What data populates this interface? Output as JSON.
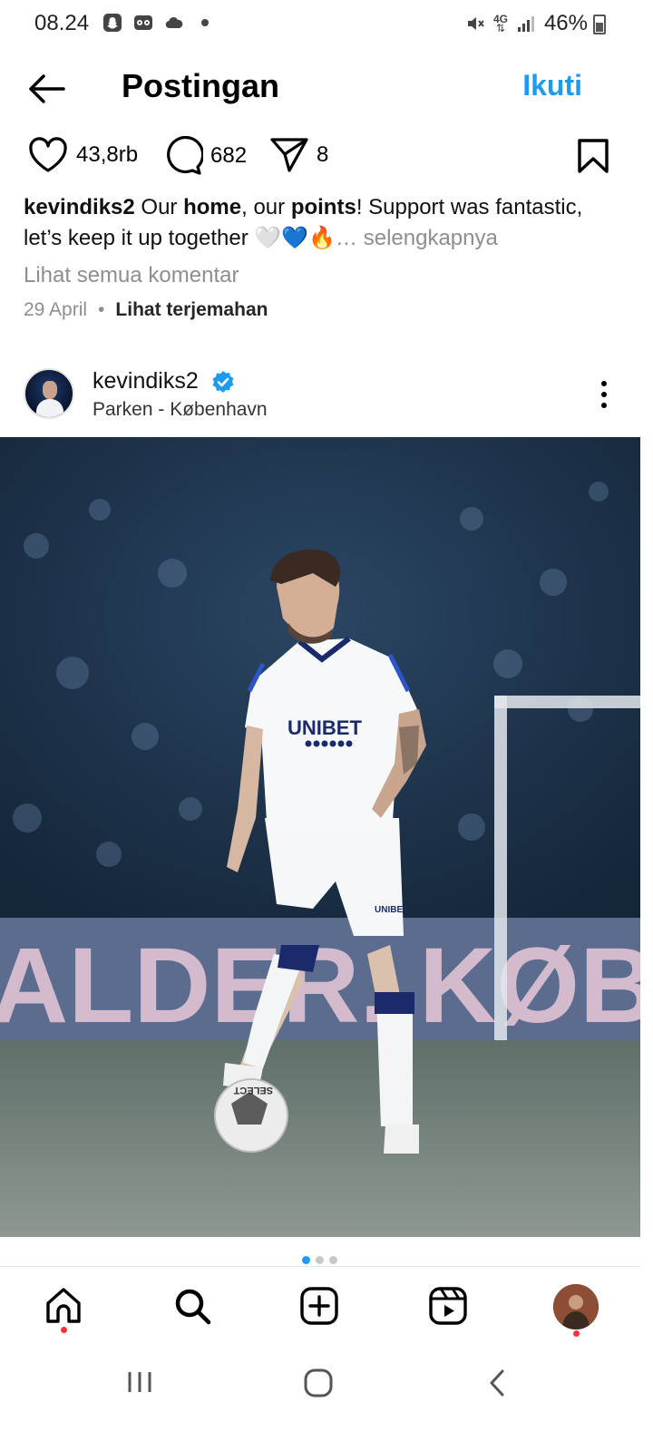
{
  "status_bar": {
    "time": "08.24",
    "network": "4G",
    "battery": "46%"
  },
  "header": {
    "title": "Postingan",
    "follow_label": "Ikuti"
  },
  "actions": {
    "likes": "43,8rb",
    "comments": "682",
    "shares": "8"
  },
  "caption": {
    "username": "kevindiks2",
    "text_1": " Our ",
    "bold_1": "home",
    "text_2": ", our ",
    "bold_2": "points",
    "text_3": "! Support was fantastic, let’s keep it up together ",
    "emojis": "🤍💙🔥",
    "more": "… selengkapnya"
  },
  "view_comments": "Lihat semua komentar",
  "meta": {
    "date": "29 April",
    "separator": "•",
    "translate": "Lihat terjemahan"
  },
  "next_post": {
    "username": "kevindiks2",
    "location": "Parken  - København",
    "photo": {
      "sponsor": "UNIBET",
      "shorts_sponsor": "UNIBET",
      "ball_brand": "SELECT",
      "banner_text": "ALDER. KØB"
    }
  },
  "carousel": {
    "count": 3,
    "active_index": 0
  },
  "bottom_nav": {
    "items": [
      "home-icon",
      "search-icon",
      "create-icon",
      "reels-icon",
      "profile-avatar"
    ]
  },
  "colors": {
    "accent": "#1d9bf0",
    "notification": "#ff3040",
    "muted": "#8e8e8e"
  }
}
